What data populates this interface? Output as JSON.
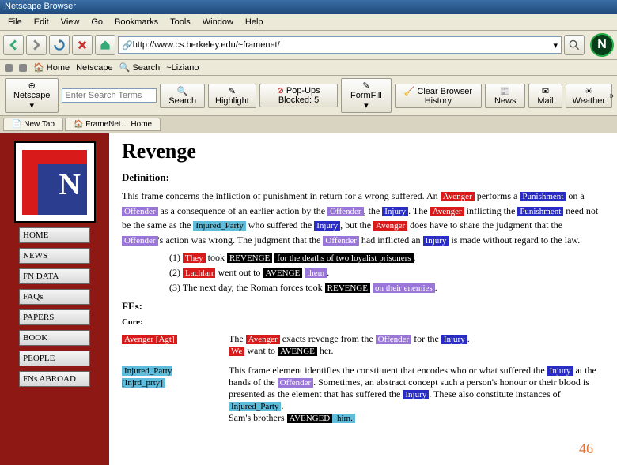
{
  "title": "Netscape Browser",
  "menu": [
    "File",
    "Edit",
    "View",
    "Go",
    "Bookmarks",
    "Tools",
    "Window",
    "Help"
  ],
  "url": "http://www.cs.berkeley.edu/~framenet/",
  "links_row": [
    "Home",
    "Netscape",
    "Search",
    "~Liziano"
  ],
  "search_placeholder": "Enter Search Terms",
  "toolbar_buttons": [
    "Search",
    "Highlight"
  ],
  "popup_label": "Pop-Ups Blocked: 5",
  "browser_tools": [
    "FormFill",
    "Clear Browser History",
    "News",
    "Mail",
    "Weather"
  ],
  "tabs": [
    "New Tab",
    "FrameNet… Home"
  ],
  "sidebar_nav": [
    "HOME",
    "NEWS",
    "FN DATA",
    "FAQs",
    "PAPERS",
    "BOOK",
    "PEOPLE",
    "FNs ABROAD"
  ],
  "page": {
    "title": "Revenge",
    "def_heading": "Definition:",
    "def_parts": [
      "This frame concerns the infliction of punishment in return for a wrong suffered. An ",
      " performs a ",
      " on a ",
      " as a consequence of an earlier action by the ",
      ", the ",
      ". The ",
      " inflicting the ",
      " need not be the same as the ",
      " who suffered the ",
      ", but the ",
      " does have to share the judgment that the ",
      "'s action was wrong. The judgment that the ",
      " had inflicted an ",
      " is made without regard to the law."
    ],
    "tags": {
      "avenger": "Avenger",
      "punishment": "Punishment",
      "offender": "Offender",
      "injury": "Injury",
      "injured_party": "Injured_Party"
    },
    "examples": [
      {
        "n": "(1)",
        "pre": "They",
        "tgt": "REVENGE",
        "post": "for the deaths of two loyalist prisoners",
        "pre_tag": "red",
        "post_tag": "black",
        "pre_extra": " took "
      },
      {
        "n": "(2)",
        "pre": "Lachlan",
        "tgt": "AVENGE",
        "post": "them",
        "pre_tag": "red",
        "post_tag": "purple",
        "pre_extra": " went out to "
      },
      {
        "n": "(3)",
        "plain": "The next day, the Roman forces took ",
        "tgt": "REVENGE",
        "post": "on their enemies",
        "post_tag": "purple"
      }
    ],
    "fes_heading": "FEs:",
    "core_heading": "Core:",
    "fe_avenger": {
      "label": "Avenger [Agt]",
      "desc_parts": [
        "The ",
        " exacts revenge from the ",
        " for the "
      ],
      "ex_parts": [
        "We",
        " want to ",
        "AVENGE",
        " her."
      ]
    },
    "fe_injured": {
      "label": "Injured_Party [Injrd_prty]",
      "desc_parts": [
        "This frame element identifies the constituent that encodes who or what suffered the ",
        " at the hands of the ",
        ". Sometimes, an abstract concept such a person's honour or their blood is presented as the element that has suffered the ",
        ". These also constitute instances of ",
        "."
      ],
      "ex_parts": [
        "Sam's brothers ",
        "AVENGED",
        " him."
      ]
    }
  },
  "slide_number": "46"
}
